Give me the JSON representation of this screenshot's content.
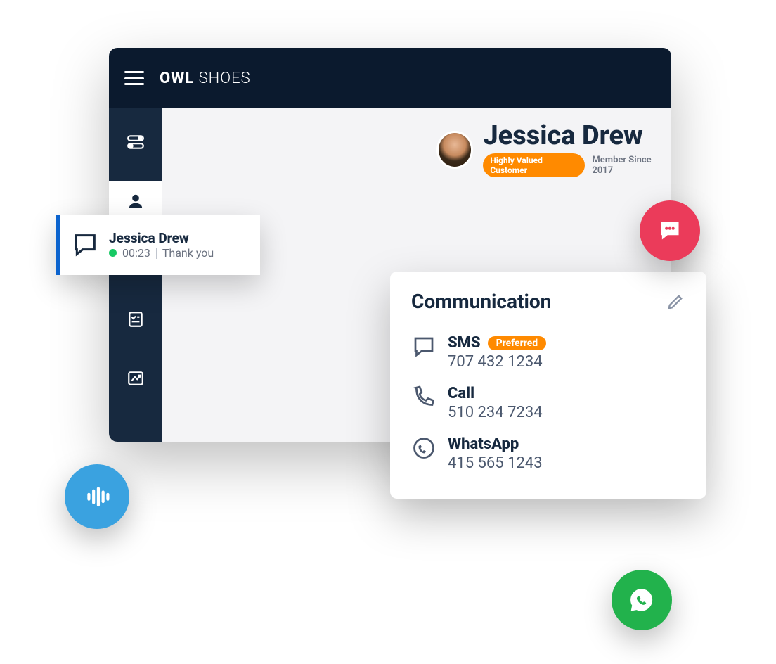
{
  "brand": {
    "bold": "OWL",
    "rest": " SHOES"
  },
  "sidebar": {
    "items": [
      {
        "name": "settings-toggle"
      },
      {
        "name": "profile"
      },
      {
        "name": "card-list"
      },
      {
        "name": "checklist"
      },
      {
        "name": "chart"
      }
    ]
  },
  "customer": {
    "name": "Jessica Drew",
    "badge": "Highly Valued Customer",
    "member": "Member Since 2017"
  },
  "conversation": {
    "name": "Jessica Drew",
    "time": "00:23",
    "preview": "Thank you"
  },
  "communication": {
    "title": "Communication",
    "items": [
      {
        "label": "SMS",
        "value": "707 432 1234",
        "preferred": true,
        "preferred_label": "Preferred",
        "icon": "chat"
      },
      {
        "label": "Call",
        "value": "510 234 7234",
        "preferred": false,
        "icon": "phone"
      },
      {
        "label": "WhatsApp",
        "value": "415 565 1243",
        "preferred": false,
        "icon": "whatsapp"
      }
    ]
  },
  "floaters": {
    "chat_icon": "chat-dots",
    "voice_icon": "waveform",
    "whatsapp_icon": "whatsapp"
  }
}
